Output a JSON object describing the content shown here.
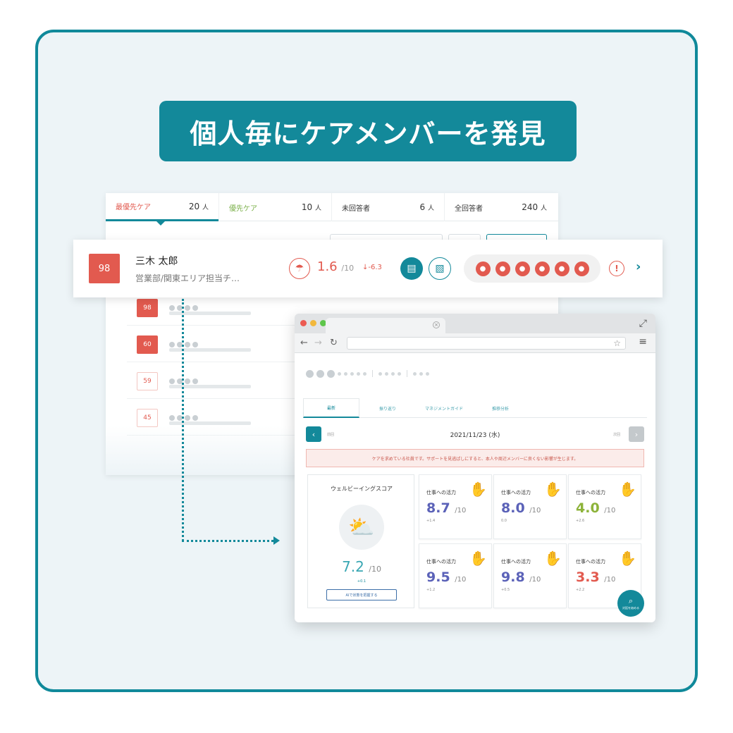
{
  "headline": "個人毎にケアメンバーを発見",
  "tabs": [
    {
      "label": "最優先ケア",
      "count": "20",
      "unit": "人",
      "color": "#e25a4f"
    },
    {
      "label": "優先ケア",
      "count": "10",
      "unit": "人",
      "color": "#7bb04a"
    },
    {
      "label": "未回答者",
      "count": "6",
      "unit": "人",
      "color": "#333333"
    },
    {
      "label": "全回答者",
      "count": "240",
      "unit": "人",
      "color": "#333333"
    }
  ],
  "highlight": {
    "score": "98",
    "name": "三木 太郎",
    "department": "営業部/関東エリア担当チ…",
    "weather_score": "1.6",
    "weather_max": "/10",
    "weather_delta": "-6.3",
    "alert": "!",
    "chevron": "›"
  },
  "rows": [
    {
      "score": "98",
      "level": "hi"
    },
    {
      "score": "60",
      "level": "hi"
    },
    {
      "score": "59",
      "level": "mid"
    },
    {
      "score": "45",
      "level": "mid"
    }
  ],
  "browser": {
    "tabs": [
      "最新",
      "振り返り",
      "マネジメントガイド",
      "推移分析"
    ],
    "date": "2021/11/23 (水)",
    "prev_label": "前回",
    "next_label": "次回",
    "notice": "ケアを求めている社員です。サポートを見逃ぱしにすると、本人や周辺メンバーに良くない影響が生じます。",
    "wellbeing": {
      "title": "ウェルビーイングスコア",
      "score": "7.2",
      "max": "/10",
      "delta": "+0.1",
      "button": "AIで状態を把握する"
    },
    "metrics": [
      {
        "label": "仕事への活力",
        "score": "8.7",
        "max": "/10",
        "delta": "+1.4",
        "color": "#5b62b8"
      },
      {
        "label": "仕事への活力",
        "score": "8.0",
        "max": "/10",
        "delta": "0.0",
        "color": "#5b62b8"
      },
      {
        "label": "仕事への活力",
        "score": "4.0",
        "max": "/10",
        "delta": "+2.6",
        "color": "#8db33a"
      },
      {
        "label": "仕事への活力",
        "score": "9.5",
        "max": "/10",
        "delta": "+1.2",
        "color": "#5b62b8"
      },
      {
        "label": "仕事への活力",
        "score": "9.8",
        "max": "/10",
        "delta": "+0.5",
        "color": "#5b62b8"
      },
      {
        "label": "仕事への活力",
        "score": "3.3",
        "max": "/10",
        "delta": "+2.2",
        "color": "#e25a4f"
      }
    ],
    "fab_label": "対話を始める"
  },
  "icons": {
    "weather": "rain-cloud-icon",
    "comment": "comment-icon",
    "document": "document-icon",
    "factor_icons": 6
  }
}
